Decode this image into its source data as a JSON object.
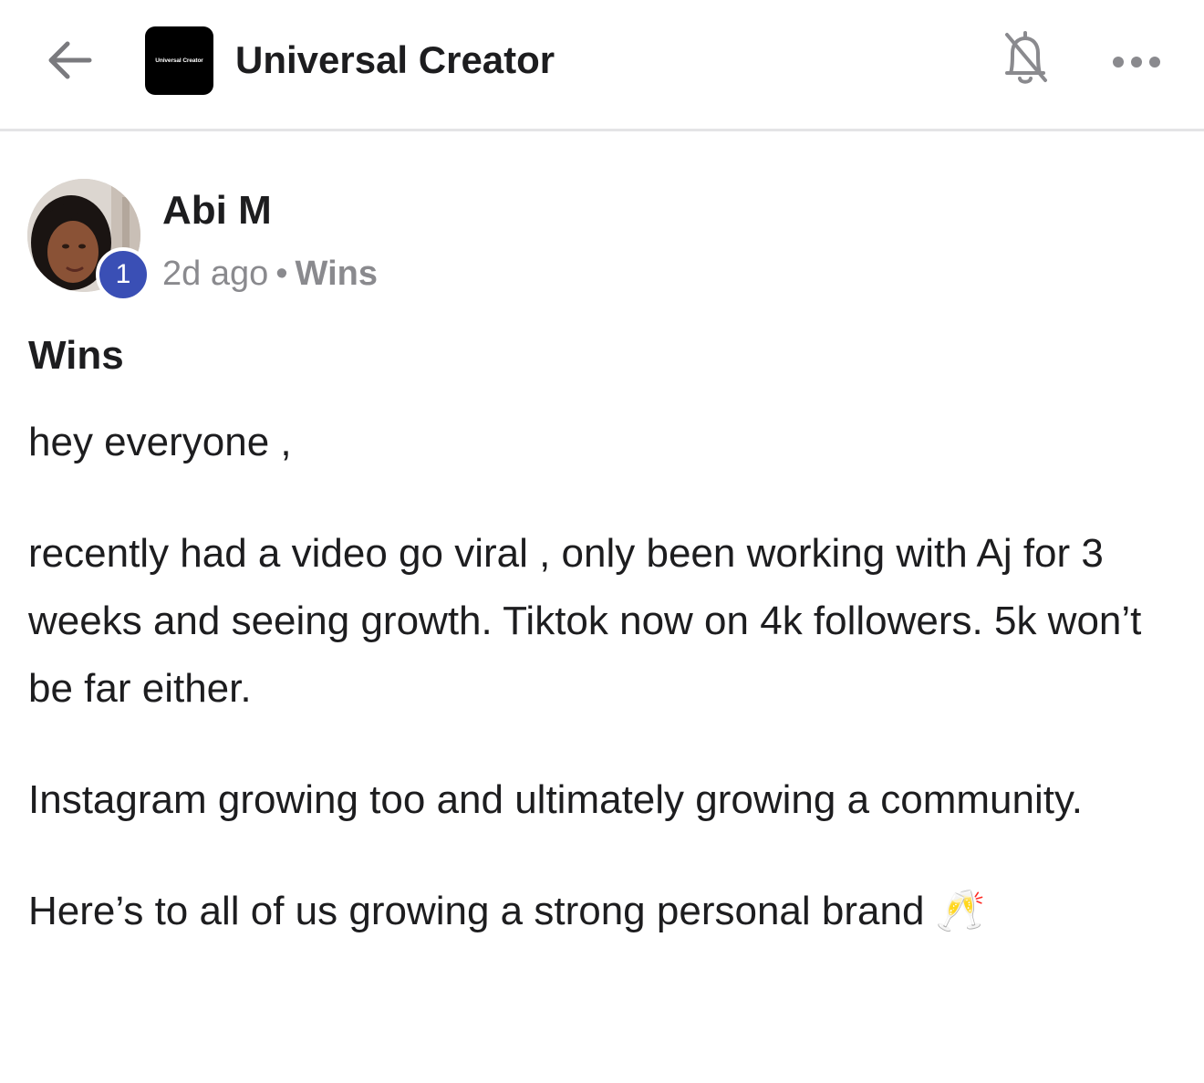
{
  "header": {
    "back_icon": "arrow-left-icon",
    "logo_text": "Universal Creator",
    "title": "Universal Creator",
    "bell_icon": "bell-off-icon",
    "more_icon": "more-horizontal-icon"
  },
  "post": {
    "author": "Abi M",
    "level": "1",
    "time_ago": "2d ago",
    "separator": "•",
    "category": "Wins",
    "title": "Wins",
    "paragraphs": [
      "hey everyone ,",
      "recently had a video go viral , only been working with Aj for 3 weeks and seeing growth. Tiktok now on 4k followers. 5k won’t be far either.",
      "Instagram growing too and ultimately growing a community.",
      "Here’s to all of us growing a strong personal brand 🥂"
    ]
  },
  "colors": {
    "accent": "#3a4fb5",
    "text": "#1d1d1f",
    "muted": "#8a8a8e",
    "divider": "#e4e4e6"
  }
}
